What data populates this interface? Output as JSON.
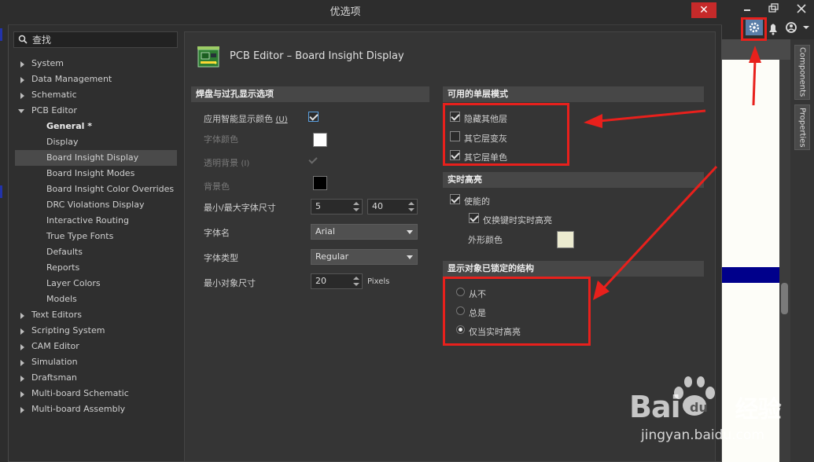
{
  "dialog": {
    "title": "优选项",
    "close_label": "✕"
  },
  "search": {
    "placeholder": "查找"
  },
  "tree": [
    {
      "label": "System",
      "expanded": false
    },
    {
      "label": "Data Management",
      "expanded": false
    },
    {
      "label": "Schematic",
      "expanded": false
    },
    {
      "label": "PCB Editor",
      "expanded": true
    },
    {
      "label": "General *"
    },
    {
      "label": "Display"
    },
    {
      "label": "Board Insight Display",
      "selected": true
    },
    {
      "label": "Board Insight Modes"
    },
    {
      "label": "Board Insight Color Overrides"
    },
    {
      "label": "DRC Violations Display"
    },
    {
      "label": "Interactive Routing"
    },
    {
      "label": "True Type Fonts"
    },
    {
      "label": "Defaults"
    },
    {
      "label": "Reports"
    },
    {
      "label": "Layer Colors"
    },
    {
      "label": "Models"
    },
    {
      "label": "Text Editors",
      "expanded": false
    },
    {
      "label": "Scripting System",
      "expanded": false
    },
    {
      "label": "CAM Editor",
      "expanded": false
    },
    {
      "label": "Simulation",
      "expanded": false
    },
    {
      "label": "Draftsman",
      "expanded": false
    },
    {
      "label": "Multi-board Schematic",
      "expanded": false
    },
    {
      "label": "Multi-board Assembly",
      "expanded": false
    }
  ],
  "page": {
    "header": "PCB Editor – Board Insight Display"
  },
  "pad_via": {
    "title": "焊盘与过孔显示选项",
    "smart_color_label": "应用智能显示颜色",
    "smart_color_shortcut": "(U)",
    "smart_color_checked": true,
    "font_color_label": "字体颜色",
    "font_color": "#ffffff",
    "transparent_bg_label": "透明背景",
    "transparent_bg_shortcut": "(I)",
    "transparent_bg_checked": true,
    "bg_color_label": "背景色",
    "bg_color": "#000000",
    "font_size_label": "最小/最大字体尺寸",
    "font_min": "5",
    "font_max": "40",
    "font_name_label": "字体名",
    "font_name": "Arial",
    "font_style_label": "字体类型",
    "font_style": "Regular",
    "min_object_label": "最小对象尺寸",
    "min_object_value": "20",
    "min_object_unit": "Pixels"
  },
  "single_layer": {
    "title": "可用的单层模式",
    "options": [
      {
        "label": "隐藏其他层",
        "checked": true
      },
      {
        "label": "其它层变灰",
        "checked": false
      },
      {
        "label": "其它层单色",
        "checked": true
      }
    ]
  },
  "live_highlight": {
    "title": "实时高亮",
    "enabled_label": "使能的",
    "enabled_checked": true,
    "shift_only_label": "仅换键时实时高亮",
    "shift_only_checked": true,
    "outline_color_label": "外形颜色",
    "outline_color": "#ecebd0"
  },
  "locked_structure": {
    "title": "显示对象已锁定的结构",
    "options": [
      {
        "label": "从不",
        "selected": false
      },
      {
        "label": "总是",
        "selected": false
      },
      {
        "label": "仅当实时高亮",
        "selected": true
      }
    ]
  },
  "app_side": {
    "tab_components": "Components",
    "tab_properties": "Properties"
  },
  "annotation_color": "#e8201c",
  "watermark": {
    "brand": "Bai",
    "brand2": "经验",
    "url": "jingyan.baidu.com"
  }
}
